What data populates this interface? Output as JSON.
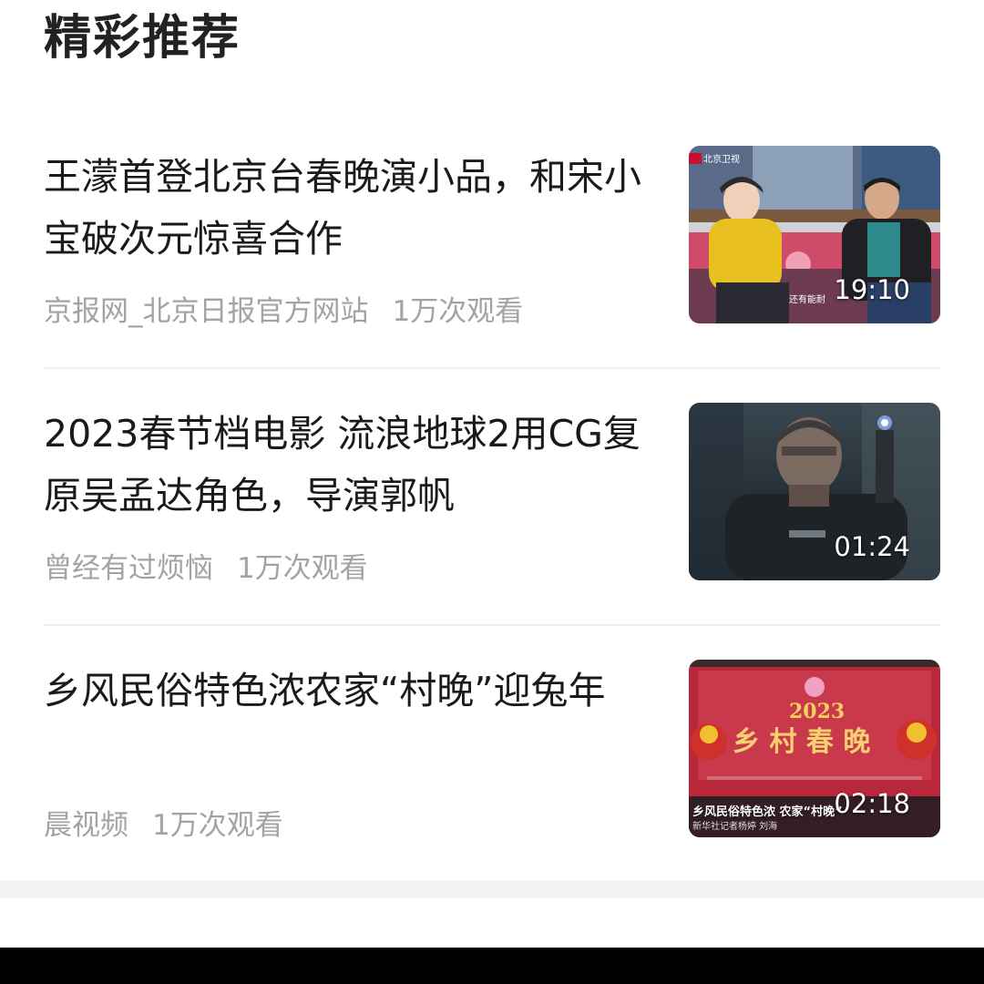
{
  "section": {
    "title": "精彩推荐"
  },
  "items": [
    {
      "title": "王濛首登北京台春晚演小品，和宋小宝破次元惊喜合作",
      "source": "京报网_北京日报官方网站",
      "views": "1万次观看",
      "duration": "19:10",
      "thumb_icon": "video-thumbnail-skit"
    },
    {
      "title": "2023春节档电影 流浪地球2用CG复原吴孟达角色，导演郭帆",
      "source": "曾经有过烦恼",
      "views": "1万次观看",
      "duration": "01:24",
      "thumb_icon": "video-thumbnail-movie"
    },
    {
      "title": "乡风民俗特色浓农家“村晚”迎兔年",
      "source": "晨视频",
      "views": "1万次观看",
      "duration": "02:18",
      "thumb_icon": "video-thumbnail-village-gala",
      "thumb_caption": "乡风民俗特色浓 农家“村晚”",
      "thumb_subcaption": "新华社记者杨婷 刘海"
    }
  ],
  "colors": {
    "title_text": "#1a1a1a",
    "meta_text": "#a3a3a3",
    "divider": "#eeeeee",
    "duration_text": "#ffffff"
  }
}
